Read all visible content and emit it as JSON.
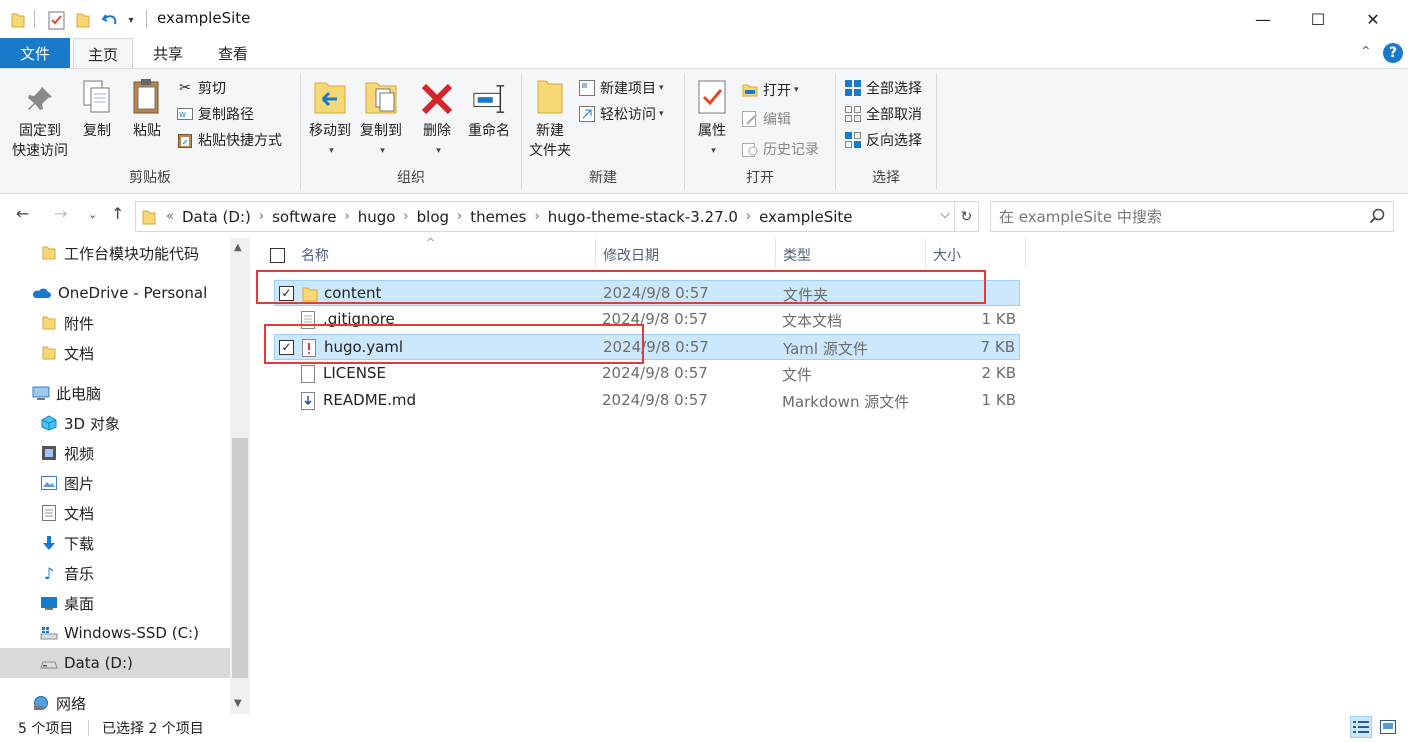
{
  "window": {
    "title": "exampleSite",
    "minimize": "—",
    "maximize": "☐",
    "close": "✕"
  },
  "tabs": [
    {
      "label": "文件"
    },
    {
      "label": "主页"
    },
    {
      "label": "共享"
    },
    {
      "label": "查看"
    }
  ],
  "ribbon": {
    "clipboard": {
      "pin_label_1": "固定到",
      "pin_label_2": "快速访问",
      "copy_label": "复制",
      "paste_label": "粘贴",
      "cut_label": "剪切",
      "copy_path_label": "复制路径",
      "paste_shortcut_label": "粘贴快捷方式",
      "group_label": "剪贴板"
    },
    "organize": {
      "move_to_label": "移动到",
      "copy_to_label": "复制到",
      "delete_label": "删除",
      "rename_label": "重命名",
      "group_label": "组织"
    },
    "new": {
      "new_folder_label_1": "新建",
      "new_folder_label_2": "文件夹",
      "new_item_label": "新建项目",
      "easy_access_label": "轻松访问",
      "group_label": "新建"
    },
    "open": {
      "properties_label": "属性",
      "open_label": "打开",
      "edit_label": "编辑",
      "history_label": "历史记录",
      "group_label": "打开"
    },
    "select": {
      "select_all_label": "全部选择",
      "select_none_label": "全部取消",
      "invert_label": "反向选择",
      "group_label": "选择"
    }
  },
  "address": {
    "overflow": "«",
    "crumbs": [
      "Data (D:)",
      "software",
      "hugo",
      "blog",
      "themes",
      "hugo-theme-stack-3.27.0",
      "exampleSite"
    ],
    "search_placeholder": "在 exampleSite 中搜索"
  },
  "nav": {
    "items": [
      {
        "label": "工作台模块功能代码",
        "icon": "folder-icon"
      },
      {
        "label": "OneDrive - Personal",
        "icon": "cloud-icon"
      },
      {
        "label": "附件",
        "icon": "folder-icon"
      },
      {
        "label": "文档",
        "icon": "folder-icon"
      },
      {
        "label": "此电脑",
        "icon": "computer-icon"
      },
      {
        "label": "3D 对象",
        "icon": "cube-icon"
      },
      {
        "label": "视频",
        "icon": "video-icon"
      },
      {
        "label": "图片",
        "icon": "picture-icon"
      },
      {
        "label": "文档",
        "icon": "document-icon"
      },
      {
        "label": "下载",
        "icon": "download-icon"
      },
      {
        "label": "音乐",
        "icon": "music-icon"
      },
      {
        "label": "桌面",
        "icon": "desktop-icon"
      },
      {
        "label": "Windows-SSD (C:)",
        "icon": "drive-icon"
      },
      {
        "label": "Data (D:)",
        "icon": "drive-icon"
      },
      {
        "label": "网络",
        "icon": "network-icon"
      }
    ]
  },
  "filelist": {
    "columns": {
      "name": "名称",
      "date": "修改日期",
      "type": "类型",
      "size": "大小"
    },
    "rows": [
      {
        "name": "content",
        "date": "2024/9/8 0:57",
        "type": "文件夹",
        "size": "",
        "selected": true,
        "icon": "folder-icon"
      },
      {
        "name": ".gitignore",
        "date": "2024/9/8 0:57",
        "type": "文本文档",
        "size": "1 KB",
        "selected": false,
        "icon": "text-file-icon"
      },
      {
        "name": "hugo.yaml",
        "date": "2024/9/8 0:57",
        "type": "Yaml 源文件",
        "size": "7 KB",
        "selected": true,
        "icon": "yaml-file-icon"
      },
      {
        "name": "LICENSE",
        "date": "2024/9/8 0:57",
        "type": "文件",
        "size": "2 KB",
        "selected": false,
        "icon": "file-icon"
      },
      {
        "name": "README.md",
        "date": "2024/9/8 0:57",
        "type": "Markdown 源文件",
        "size": "1 KB",
        "selected": false,
        "icon": "markdown-file-icon"
      }
    ]
  },
  "status": {
    "count": "5 个项目",
    "selected": "已选择 2 个项目"
  },
  "colors": {
    "accent": "#1979ca",
    "selection": "#cce8ff",
    "highlight_box": "#e03a3a",
    "folder": "#f8d775"
  }
}
